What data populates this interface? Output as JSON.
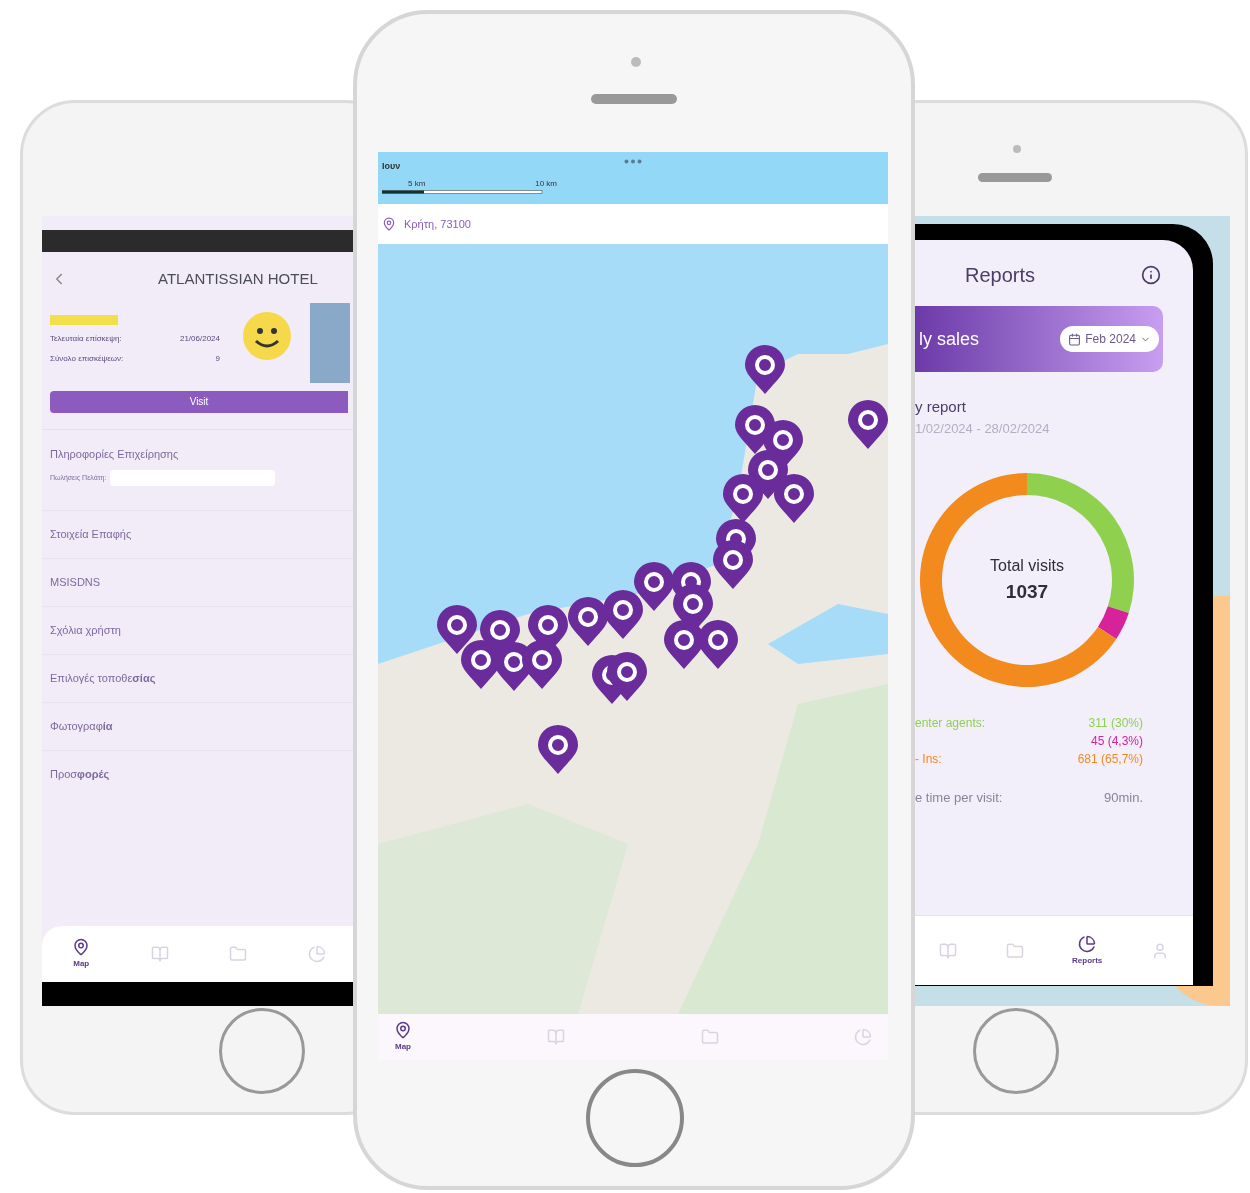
{
  "hotel_phone": {
    "title": "ATLANTISSIAN HOTEL",
    "details": [
      {
        "label": "Τελευταία επίσκεψη:",
        "value": "21/06/2024"
      },
      {
        "label": "Σύνολο επισκέψεων:",
        "value": "9"
      }
    ],
    "visit_button": "Visit",
    "section_title": "Πληροφορίες Επιχείρησης",
    "sales_field": {
      "label": "Πωλήσεις Πελάτη:"
    },
    "menu": [
      "Στοιχεία Επαφής",
      "MSISDNS",
      "Σχόλια χρήστη",
      "Επιλογές τοποθε**σίας**",
      "Φωτογραφ**ία**",
      "Προσ**φορές**"
    ],
    "nav": [
      {
        "kind": "map",
        "label": "Map",
        "selected": true
      },
      {
        "kind": "book",
        "selected": false
      },
      {
        "kind": "folder",
        "selected": false
      },
      {
        "kind": "chart",
        "selected": false
      }
    ]
  },
  "map_phone": {
    "map_label": "Ιουν",
    "scale": [
      "5 km",
      "10 km"
    ],
    "location": "Κρήτη, 73100",
    "nav": [
      {
        "kind": "map",
        "label": "Map",
        "selected": true
      },
      {
        "kind": "book",
        "selected": false
      },
      {
        "kind": "folder",
        "selected": false
      },
      {
        "kind": "chart",
        "selected": false
      }
    ]
  },
  "reports_phone": {
    "title": "Reports",
    "banner": "ly sales",
    "month": "Feb 2024",
    "report_title": "y report",
    "report_range": "1/02/2024 - 28/02/2024",
    "total_label": "Total visits",
    "total_value": "1037",
    "chart_data": {
      "type": "donut",
      "values": [
        30,
        4.3,
        65.7
      ]
    },
    "stats": [
      {
        "label": "enter agents:",
        "value": "311 (30%)",
        "color": "#8fd14f"
      },
      {
        "value": "45 (4,3%)",
        "color": "#d6239a"
      },
      {
        "label": "- Ins:",
        "value": "681 (65,7%)",
        "color": "#f28a1e"
      }
    ],
    "time_label": "e time per visit:",
    "time_value": "90min.",
    "nav": [
      {
        "kind": "book",
        "selected": false
      },
      {
        "kind": "folder",
        "selected": false
      },
      {
        "kind": "chart",
        "label": "Reports",
        "selected": true
      },
      {
        "kind": "person",
        "selected": false
      }
    ]
  }
}
